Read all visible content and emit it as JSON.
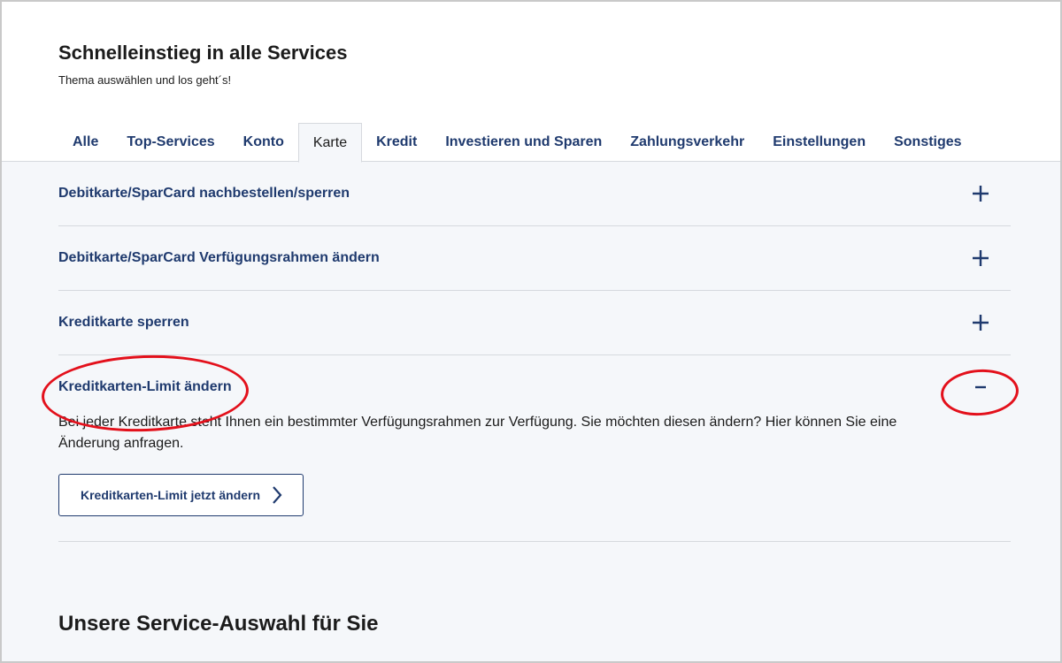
{
  "header": {
    "title": "Schnelleinstieg in alle Services",
    "subtitle": "Thema auswählen und los geht´s!"
  },
  "tabs": [
    {
      "label": "Alle"
    },
    {
      "label": "Top-Services"
    },
    {
      "label": "Konto"
    },
    {
      "label": "Karte",
      "active": true
    },
    {
      "label": "Kredit"
    },
    {
      "label": "Investieren und Sparen"
    },
    {
      "label": "Zahlungsverkehr"
    },
    {
      "label": "Einstellungen"
    },
    {
      "label": "Sonstiges"
    }
  ],
  "accordion": {
    "items": [
      {
        "title": "Debitkarte/SparCard nachbestellen/sperren",
        "icon": "plus-icon",
        "expanded": false
      },
      {
        "title": "Debitkarte/SparCard Verfügungsrahmen ändern",
        "icon": "plus-icon",
        "expanded": false
      },
      {
        "title": "Kreditkarte sperren",
        "icon": "plus-icon",
        "expanded": false
      },
      {
        "title": "Kreditkarten-Limit ändern",
        "icon": "minus-icon",
        "expanded": true,
        "text": "Bei jeder Kreditkarte steht Ihnen ein bestimmter Verfügungsrahmen zur Verfügung. Sie möchten diesen ändern? Hier können Sie eine Änderung anfragen.",
        "button_label": "Kreditkarten-Limit jetzt ändern",
        "button_icon": "chevron-right-icon"
      }
    ]
  },
  "section": {
    "title": "Unsere Service-Auswahl für Sie"
  },
  "colors": {
    "brand_blue": "#1f3a6e",
    "annotation_red": "#e3101b",
    "panel_bg": "#f5f7fa"
  }
}
